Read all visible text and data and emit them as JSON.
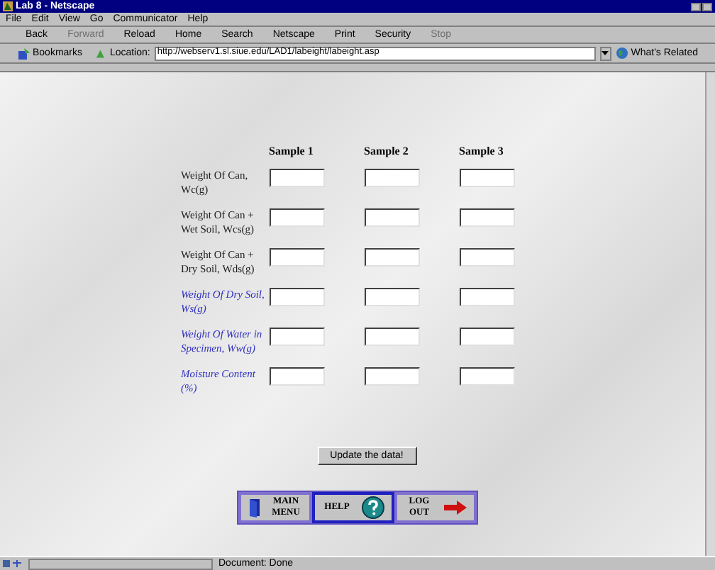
{
  "window": {
    "title": "Lab 8 - Netscape"
  },
  "menu": [
    "File",
    "Edit",
    "View",
    "Go",
    "Communicator",
    "Help"
  ],
  "toolbar": [
    {
      "label": "Back",
      "disabled": false
    },
    {
      "label": "Forward",
      "disabled": true
    },
    {
      "label": "Reload",
      "disabled": false
    },
    {
      "label": "Home",
      "disabled": false
    },
    {
      "label": "Search",
      "disabled": false
    },
    {
      "label": "Netscape",
      "disabled": false
    },
    {
      "label": "Print",
      "disabled": false
    },
    {
      "label": "Security",
      "disabled": false
    },
    {
      "label": "Stop",
      "disabled": true
    }
  ],
  "location_bar": {
    "bookmarks": "Bookmarks",
    "label": "Location:",
    "url": "http://webserv1.sl.siue.edu/LAD1/labeight/labeight.asp",
    "related": "What's Related"
  },
  "table": {
    "columns": [
      "Sample 1",
      "Sample 2",
      "Sample 3"
    ],
    "rows": [
      {
        "label": "Weight Of Can, Wc(g)",
        "kind": "input"
      },
      {
        "label": "Weight Of Can + Wet Soil, Wcs(g)",
        "kind": "input"
      },
      {
        "label": "Weight Of Can + Dry Soil, Wds(g)",
        "kind": "input"
      },
      {
        "label": "Weight Of Dry Soil, Ws(g)",
        "kind": "computed"
      },
      {
        "label": "Weight Of Water in Specimen, Ww(g)",
        "kind": "computed"
      },
      {
        "label": "Moisture Content (%)",
        "kind": "computed"
      }
    ]
  },
  "update_button": "Update the data!",
  "nav_buttons": [
    "MAIN MENU",
    "HELP",
    "LOG OUT"
  ],
  "status_bar": {
    "text": "Document: Done"
  }
}
